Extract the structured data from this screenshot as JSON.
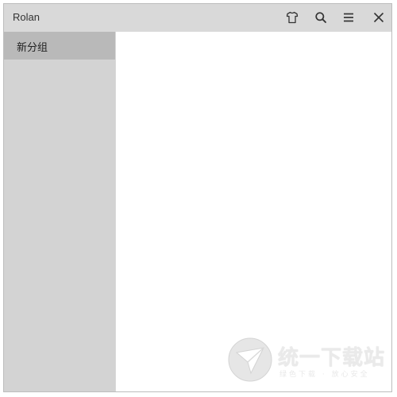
{
  "window": {
    "title": "Rolan"
  },
  "toolbar": {
    "icons": [
      "shirt-icon",
      "search-icon",
      "menu-icon",
      "close-icon"
    ]
  },
  "sidebar": {
    "groups": [
      {
        "label": "新分组",
        "selected": true
      }
    ]
  },
  "watermark": {
    "text": "统一下载站",
    "subtext": "绿色下载 · 放心安全"
  },
  "colors": {
    "titlebar_bg": "#d9d9d9",
    "sidebar_bg": "#d3d3d3",
    "selected_group_bg": "#b9b9b9",
    "content_bg": "#ffffff"
  }
}
